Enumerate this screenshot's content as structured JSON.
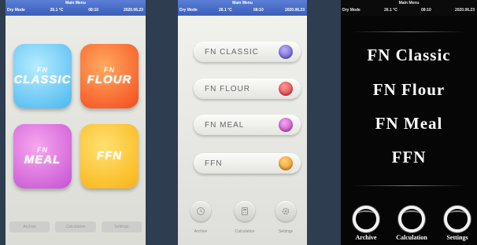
{
  "status": {
    "title": "Main Menu",
    "mode": "Dry Mode",
    "temp": "26.1 °C",
    "time": "08:10",
    "date": "2020.06.23"
  },
  "screen1": {
    "tiles": [
      {
        "top": "FN",
        "main": "CLASSIC"
      },
      {
        "top": "FN",
        "main": "FLOUR"
      },
      {
        "top": "FN",
        "main": "MEAL"
      },
      {
        "top": "",
        "main": "FFN"
      }
    ],
    "bottom": [
      "Archive",
      "Calculation",
      "Settings"
    ],
    "colors": [
      "#49b7ef",
      "#f54b1c",
      "#c651d3",
      "#f9b313"
    ]
  },
  "screen2": {
    "items": [
      {
        "label": "FN CLASSIC",
        "color": "#6a5acd"
      },
      {
        "label": "FN FLOUR",
        "color": "#e03a3a"
      },
      {
        "label": "FN MEAL",
        "color": "#c648c6"
      },
      {
        "label": "FFN",
        "color": "#f39c12"
      }
    ],
    "buttons": [
      "Archive",
      "Calculation",
      "Settings"
    ]
  },
  "screen3": {
    "items": [
      "FN Classic",
      "FN Flour",
      "FN Meal",
      "FFN"
    ],
    "buttons": [
      "Archive",
      "Calculation",
      "Settings"
    ]
  }
}
